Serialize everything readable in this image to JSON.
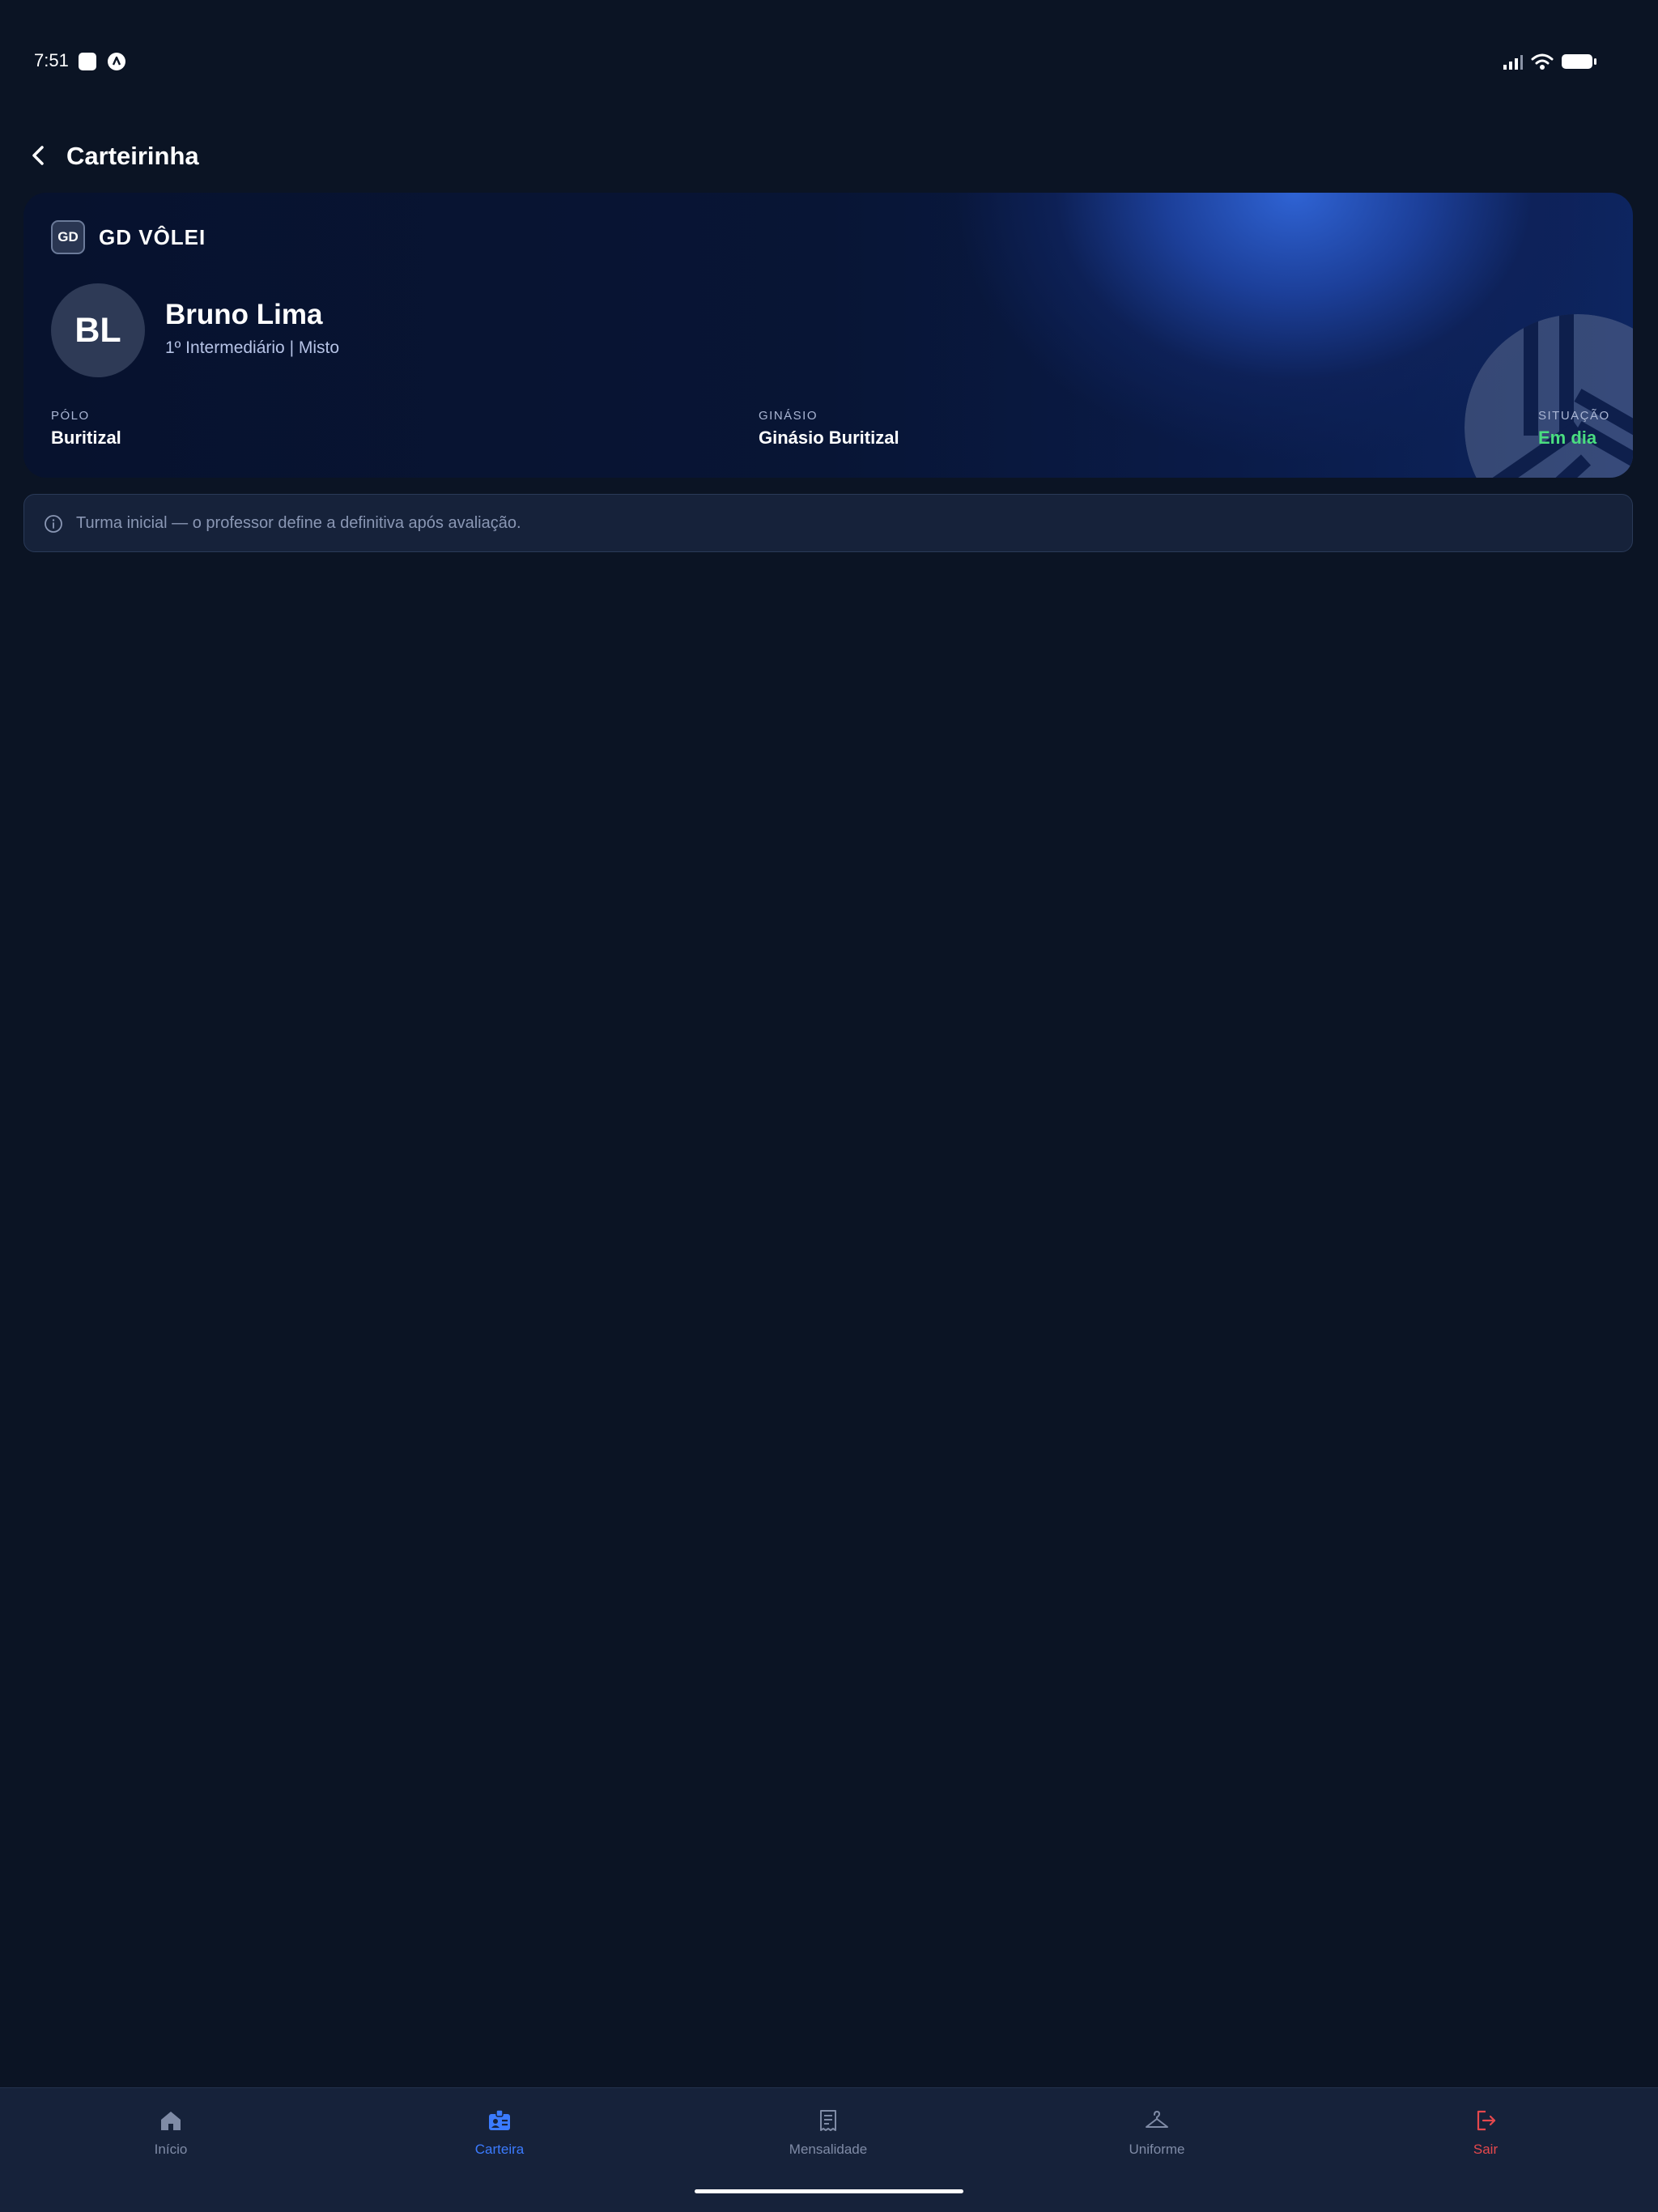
{
  "status_bar": {
    "time": "7:51",
    "icons": [
      "app-icon",
      "app-icon",
      "signal-icon",
      "wifi-icon",
      "battery-icon"
    ]
  },
  "header": {
    "title": "Carteirinha",
    "back_icon": "chevron-left-icon"
  },
  "card": {
    "brand_badge": "GD",
    "brand_name": "GD VÔLEI",
    "avatar_initials": "BL",
    "member_name": "Bruno Lima",
    "member_class": "1º Intermediário | Misto",
    "fields": [
      {
        "label": "PÓLO",
        "value": "Buritizal"
      },
      {
        "label": "GINÁSIO",
        "value": "Ginásio Buritizal"
      },
      {
        "label": "SITUAÇÃO",
        "value": "Em dia"
      }
    ],
    "watermark_icon": "volleyball-icon"
  },
  "info_note": {
    "icon": "info-icon",
    "text": "Turma inicial — o professor define a definitiva após avaliação."
  },
  "tabs": [
    {
      "label": "Início",
      "icon": "home-icon"
    },
    {
      "label": "Carteira",
      "icon": "id-card-icon",
      "active": true
    },
    {
      "label": "Mensalidade",
      "icon": "receipt-icon"
    },
    {
      "label": "Uniforme",
      "icon": "hanger-icon"
    },
    {
      "label": "Sair",
      "icon": "logout-icon"
    }
  ],
  "colors": {
    "background": "#0b1424",
    "tab_bar": "#16223a",
    "accent": "#3b7bff",
    "status_ok": "#4ade80",
    "danger": "#e5484d"
  }
}
